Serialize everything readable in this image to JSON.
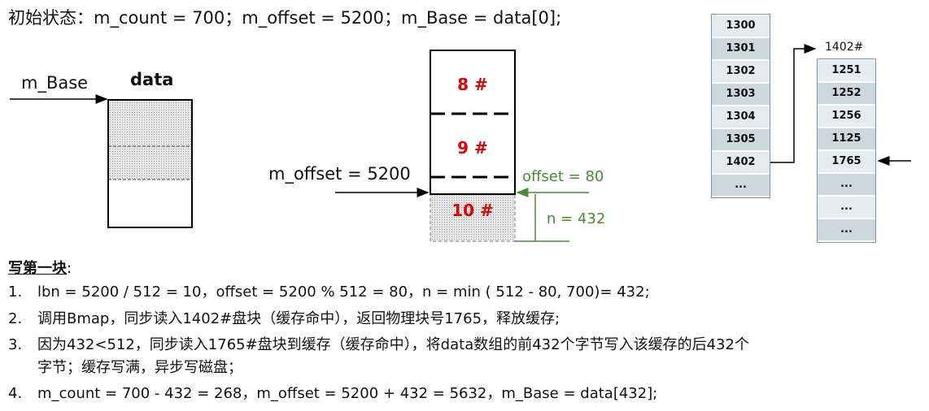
{
  "header": "初始状态：m_count = 700；m_offset = 5200；m_Base = data[0];",
  "left": {
    "title": "data",
    "pointer_label": "m_Base"
  },
  "middle": {
    "blocks": [
      "8 #",
      "9 #",
      "10 #"
    ],
    "pointer_label": "m_offset = 5200",
    "offset_label": "offset = 80",
    "n_label": "n = 432"
  },
  "right": {
    "column1": [
      "1300",
      "1301",
      "1302",
      "1303",
      "1304",
      "1305",
      "1402",
      "..."
    ],
    "column2_title": "1402#",
    "column2": [
      "1251",
      "1252",
      "1256",
      "1125",
      "1765",
      "...",
      "...",
      "..."
    ]
  },
  "section": {
    "title": "写第一块",
    "colon": ":"
  },
  "steps": [
    {
      "num": "1.",
      "text": "lbn = 5200 / 512 = 10，offset = 5200 % 512 = 80，n = min ( 512 - 80, 700)= 432;"
    },
    {
      "num": "2.",
      "text": "调用Bmap，同步读入1402#盘块（缓存命中），返回物理块号1765，释放缓存;"
    },
    {
      "num": "3.",
      "text": "因为432<512，同步读入1765#盘块到缓存（缓存命中），将data数组的前432个字节写入该缓存的后432个",
      "cont": "字节；缓存写满，异步写磁盘；"
    },
    {
      "num": "4.",
      "text": "m_count = 700 - 432 = 268，m_offset = 5200 + 432 = 5632，m_Base = data[432];"
    }
  ]
}
